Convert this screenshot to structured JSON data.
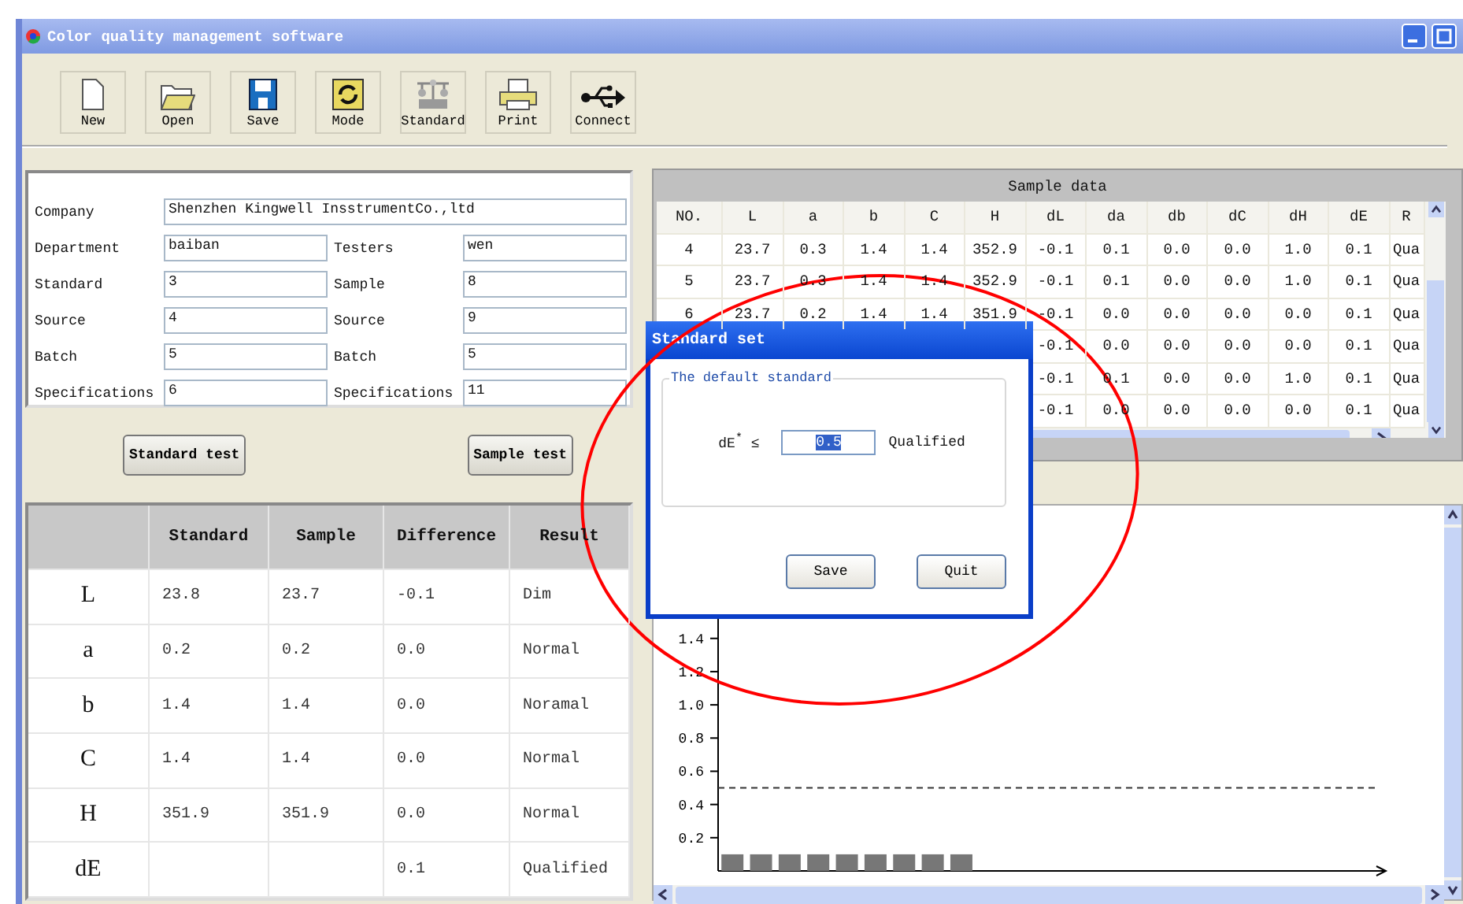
{
  "window": {
    "title": "Color quality management software"
  },
  "toolbar": [
    {
      "label": "New"
    },
    {
      "label": "Open"
    },
    {
      "label": "Save"
    },
    {
      "label": "Mode"
    },
    {
      "label": "Standard"
    },
    {
      "label": "Print"
    },
    {
      "label": "Connect"
    }
  ],
  "info_form": {
    "fields": [
      {
        "kind": "wide",
        "label": "Company",
        "value": "Shenzhen Kingwell InsstrumentCo.,ltd"
      },
      {
        "kind": "half",
        "label": "Department",
        "value": "baiban"
      },
      {
        "kind": "half",
        "label": "Testers",
        "value": "wen"
      },
      {
        "kind": "half",
        "label": "Standard",
        "value": "3"
      },
      {
        "kind": "half",
        "label": "Sample",
        "value": "8"
      },
      {
        "kind": "half",
        "label": "Source",
        "value": "4"
      },
      {
        "kind": "half",
        "label": "Source",
        "value": "9"
      },
      {
        "kind": "half",
        "label": "Batch",
        "value": "5"
      },
      {
        "kind": "half",
        "label": "Batch",
        "value": "5"
      },
      {
        "kind": "half",
        "label": "Specifications",
        "value": "6"
      },
      {
        "kind": "half",
        "label": "Specifications",
        "value": "11"
      }
    ]
  },
  "test_buttons": [
    "Standard test",
    "Sample test"
  ],
  "result_table": {
    "columns": [
      "Standard",
      "Sample",
      "Difference",
      "Result"
    ],
    "rows": [
      {
        "label": "L",
        "standard": "23.8",
        "sample": "23.7",
        "difference": "-0.1",
        "result": "Dim"
      },
      {
        "label": "a",
        "standard": "0.2",
        "sample": "0.2",
        "difference": "0.0",
        "result": "Normal"
      },
      {
        "label": "b",
        "standard": "1.4",
        "sample": "1.4",
        "difference": "0.0",
        "result": "Noramal"
      },
      {
        "label": "C",
        "standard": "1.4",
        "sample": "1.4",
        "difference": "0.0",
        "result": "Normal"
      },
      {
        "label": "H",
        "standard": "351.9",
        "sample": "351.9",
        "difference": "0.0",
        "result": "Normal"
      },
      {
        "label": "dE",
        "difference": "0.1",
        "result": "Qualified"
      }
    ]
  },
  "sample_data": {
    "title": "Sample data",
    "columns": [
      "NO.",
      "L",
      "a",
      "b",
      "C",
      "H",
      "dL",
      "da",
      "db",
      "dC",
      "dH",
      "dE",
      "R"
    ],
    "rows": [
      {
        "cells": [
          "4",
          "23.7",
          "0.3",
          "1.4",
          "1.4",
          "352.9",
          "-0.1",
          "0.1",
          "0.0",
          "0.0",
          "1.0",
          "0.1",
          "Qua"
        ]
      },
      {
        "cells": [
          "5",
          "23.7",
          "0.3",
          "1.4",
          "1.4",
          "352.9",
          "-0.1",
          "0.1",
          "0.0",
          "0.0",
          "1.0",
          "0.1",
          "Qua"
        ]
      },
      {
        "cells": [
          "6",
          "23.7",
          "0.2",
          "1.4",
          "1.4",
          "351.9",
          "-0.1",
          "0.0",
          "0.0",
          "0.0",
          "0.0",
          "0.1",
          "Qua"
        ]
      },
      {
        "cells": [
          "-0.1",
          "0.0",
          "0.0",
          "0.0",
          "0.0",
          "0.1",
          "Qua"
        ]
      },
      {
        "cells": [
          "-0.1",
          "0.1",
          "0.0",
          "0.0",
          "1.0",
          "0.1",
          "Qua"
        ]
      },
      {
        "cells": [
          "-0.1",
          "0.0",
          "0.0",
          "0.0",
          "0.0",
          "0.1",
          "Qua"
        ]
      }
    ]
  },
  "chart": {
    "chart_data": {
      "type": "bar",
      "categories": [
        null,
        null,
        null,
        null,
        null,
        null,
        null,
        null,
        null,
        null,
        null,
        null,
        null,
        null,
        null,
        null,
        null,
        null,
        null,
        null,
        null,
        null,
        null
      ],
      "values": [
        0.1,
        0.1,
        0.1,
        0.1,
        0.1,
        0.1,
        0.1,
        0.1,
        0.1,
        null,
        null,
        null,
        null,
        null,
        null,
        null,
        null,
        null,
        null,
        null,
        null,
        null,
        null
      ],
      "ylim": [
        0,
        2.2
      ],
      "yticks": [
        0.2,
        0.4,
        0.6,
        0.8,
        {
          "value": 1,
          "label": "1.0"
        },
        1.2,
        1.4
      ],
      "ref_lines": [
        {
          "axis": "y",
          "value": 0.5
        }
      ]
    }
  },
  "dialog": {
    "title": "Standard set",
    "group": "The default standard",
    "label": "dE$^{*}$ ≤",
    "value": "0.5",
    "value_selected": true,
    "unit": "Qualified",
    "buttons": [
      "Save",
      "Quit"
    ]
  },
  "overlay": {
    "kind": "ellipse"
  }
}
